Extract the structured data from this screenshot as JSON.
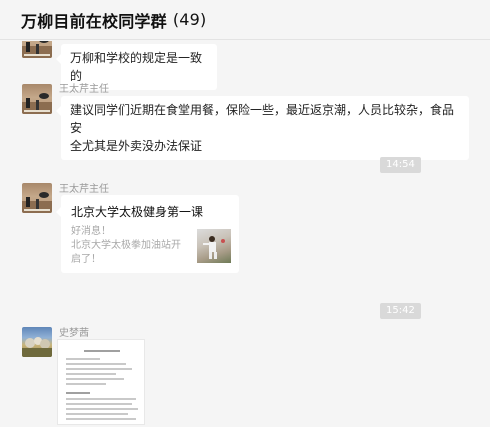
{
  "header": {
    "title": "万柳目前在校同学群",
    "count": "(49)"
  },
  "messages": {
    "m1": {
      "text": "万柳和学校的规定是一致的"
    },
    "m2": {
      "sender": "王太芹主任",
      "text_line1": "建议同学们近期在食堂用餐，保险一些，最近返京潮，人员比较杂，食品安",
      "text_line2": "全尤其是外卖没办法保证"
    },
    "ts1": "14:54",
    "m3": {
      "sender": "王太芹主任",
      "card_title": "北京大学太极健身第一课",
      "card_desc_line1": "好消息！",
      "card_desc_line2": "北京大学太极拳加油站开",
      "card_desc_line3": "启了！"
    },
    "ts2": "15:42",
    "m4": {
      "sender": "史梦茜"
    }
  },
  "icons": {
    "avatar_teacher": "cat-photo-avatar",
    "avatar_student": "landscape-photo-avatar",
    "card_thumbnail": "tai-chi-photo",
    "doc": "document-image"
  }
}
